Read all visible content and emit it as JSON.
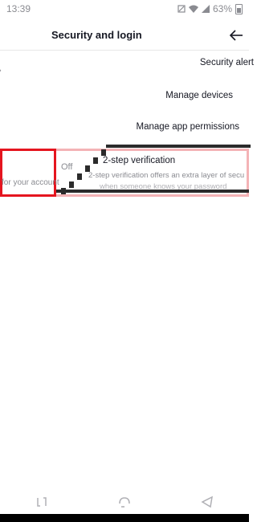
{
  "status_bar": {
    "time": "13:39",
    "battery": "63%"
  },
  "header": {
    "title": "Security and login"
  },
  "settings": {
    "security_alerts": "Security alert",
    "manage_devices": "Manage devices",
    "app_permissions": "Manage app permissions",
    "two_step": {
      "title": "2-step verification",
      "status": "Off",
      "description": "2-step verification offers an extra layer of secu",
      "description_line2": "when someone knows your password",
      "account_text": "for your account"
    }
  },
  "colors": {
    "highlight_red": "#e5151f",
    "text_primary": "#161823",
    "text_secondary": "#8a8b91"
  },
  "icons": {
    "back": "arrow-right-icon",
    "nav_recent": "recent-apps-icon",
    "nav_home": "home-icon",
    "nav_back": "back-triangle-icon"
  }
}
